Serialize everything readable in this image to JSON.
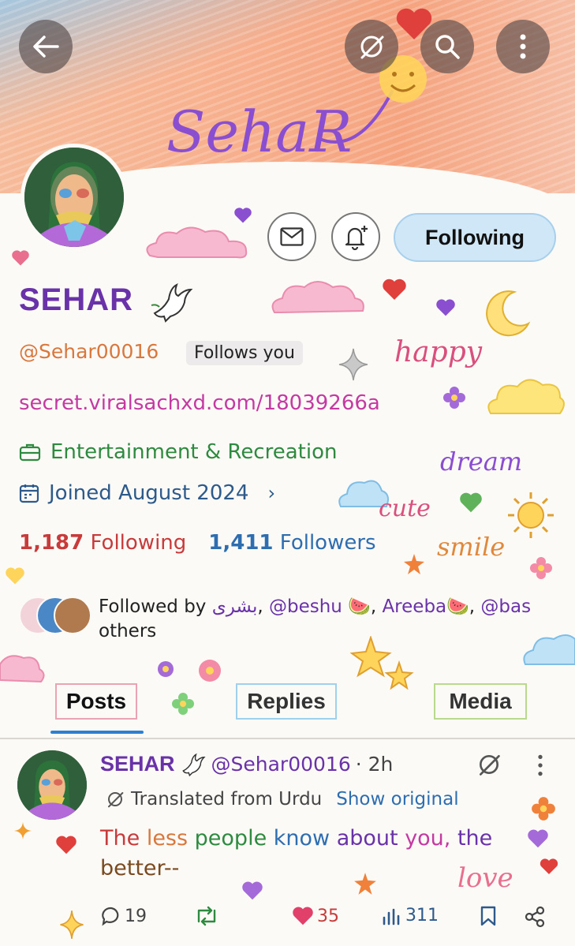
{
  "banner": {
    "script_text": "SehaR"
  },
  "topbar": {
    "back_icon": "arrow-left-icon",
    "grok_icon": "grok-icon",
    "search_icon": "search-icon",
    "more_icon": "more-vertical-icon"
  },
  "actions": {
    "message_icon": "envelope-icon",
    "notify_icon": "bell-plus-icon",
    "following_label": "Following"
  },
  "profile": {
    "display_name": "SEHAR",
    "handle": "@Sehar00016",
    "follows_you": "Follows you",
    "website": "secret.viralsachxd.com/18039266a",
    "category": "Entertainment & Recreation",
    "joined": "Joined August 2024",
    "following_count": "1,187",
    "following_label": "Following",
    "followers_count": "1,411",
    "followers_label": "Followers",
    "followed_by_prefix": "Followed by ",
    "followed_by_1": "بشری",
    "followed_by_sep1": ", ",
    "followed_by_2": "@beshu 🍉",
    "followed_by_sep2": ", ",
    "followed_by_3": "Areeba🍉",
    "followed_by_sep3": ", ",
    "followed_by_4": "@bas",
    "followed_by_suffix": "others"
  },
  "tabs": [
    {
      "label": "Posts",
      "active": true
    },
    {
      "label": "Replies",
      "active": false
    },
    {
      "label": "Media",
      "active": false
    }
  ],
  "post": {
    "name": "SEHAR",
    "handle": "@Sehar00016",
    "time": "· 2h",
    "translated_label": "Translated from Urdu",
    "show_original": "Show original",
    "text_w1": "The ",
    "text_w2": "less ",
    "text_w3": "people ",
    "text_w4": "know ",
    "text_w5": "about ",
    "text_w6": "you, ",
    "text_w7": "the ",
    "text_w8": "better--",
    "reply_count": "19",
    "like_count": "35",
    "view_count": "311"
  },
  "doodles": {
    "happy": "happy",
    "dream": "dream",
    "cute": "cute",
    "smile": "smile",
    "love": "love"
  },
  "colors": {
    "purple": "#6a32a8",
    "orange": "#d9783d",
    "magenta": "#c43aa2",
    "green": "#2e8a3f",
    "blue": "#2d6db0",
    "red": "#c83b3b",
    "following_btn": "#cfe7f6",
    "banner_peach": "#f6b08e"
  }
}
